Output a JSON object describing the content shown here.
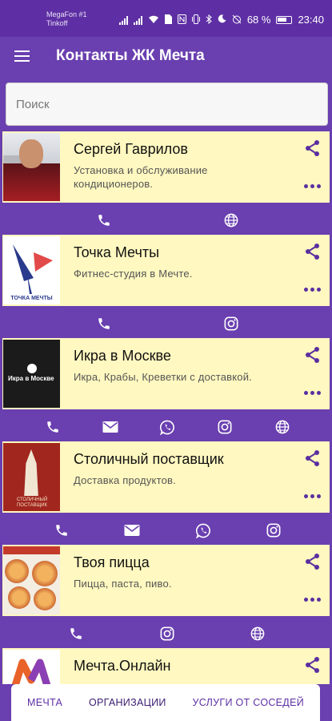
{
  "status_bar": {
    "carrier_line1": "MegaFon #1",
    "carrier_line2": "Tinkoff",
    "battery": "68 %",
    "time": "23:40"
  },
  "app_bar": {
    "title": "Контакты ЖК Мечта",
    "menu_icon": "hamburger-menu-icon"
  },
  "search": {
    "placeholder": "Поиск",
    "value": ""
  },
  "contacts": [
    {
      "name": "Сергей Гаврилов",
      "description": "Установка и обслуживание кондиционеров.",
      "actions": [
        "phone-icon",
        "globe-icon"
      ]
    },
    {
      "name": "Точка Мечты",
      "description": "Фитнес-студия в Мечте.",
      "logo_text": "ТОЧКА МЕЧТЫ",
      "actions": [
        "phone-icon",
        "instagram-icon"
      ]
    },
    {
      "name": "Икра в Москве",
      "description": "Икра, Крабы, Креветки с доставкой.",
      "logo_text": "Икра в Москве",
      "actions": [
        "phone-icon",
        "mail-icon",
        "whatsapp-icon",
        "instagram-icon",
        "globe-icon"
      ]
    },
    {
      "name": "Столичный поставщик",
      "description": "Доставка продуктов.",
      "logo_text": "СТОЛИЧНЫЙ ПОСТАВЩИК",
      "actions": [
        "phone-icon",
        "mail-icon",
        "whatsapp-icon",
        "instagram-icon"
      ]
    },
    {
      "name": "Твоя пицца",
      "description": "Пицца, паста, пиво.",
      "actions": [
        "phone-icon",
        "instagram-icon",
        "globe-icon"
      ]
    },
    {
      "name": "Мечта.Онлайн",
      "description": "",
      "actions": []
    }
  ],
  "bottom_nav": {
    "tabs": [
      {
        "label": "МЕЧТА"
      },
      {
        "label": "ОРГАНИЗАЦИИ"
      },
      {
        "label": "УСЛУГИ ОТ СОСЕДЕЙ"
      }
    ],
    "active": "ОРГАНИЗАЦИИ"
  },
  "colors": {
    "primary": "#6a3fb0",
    "status_bar": "#5e2fa4",
    "card_background": "#fff8c0",
    "icon_purple": "#5a2fa0"
  }
}
